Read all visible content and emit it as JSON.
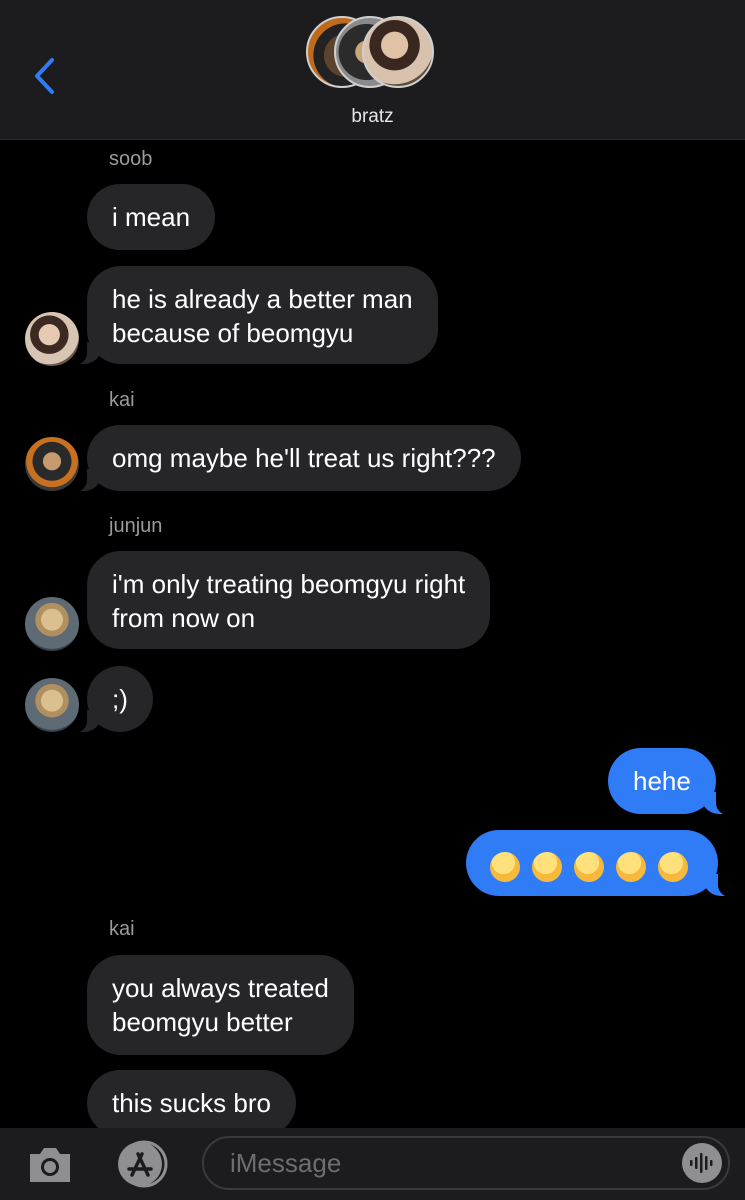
{
  "header": {
    "group_name": "bratz"
  },
  "messages": [
    {
      "type": "sender",
      "name": "soob"
    },
    {
      "type": "incoming",
      "lines": [
        "i mean"
      ]
    },
    {
      "type": "incoming",
      "lines": [
        "he is already a better man",
        "because of beomgyu"
      ]
    },
    {
      "type": "sender",
      "name": "kai"
    },
    {
      "type": "incoming",
      "lines": [
        "omg maybe he'll treat us right???"
      ]
    },
    {
      "type": "sender",
      "name": "junjun"
    },
    {
      "type": "incoming",
      "lines": [
        "i'm only treating beomgyu right",
        "from now on"
      ]
    },
    {
      "type": "incoming",
      "lines": [
        ";)"
      ]
    },
    {
      "type": "outgoing",
      "lines": [
        "hehe"
      ]
    },
    {
      "type": "outgoing",
      "emoji": [
        "face-with-hand-over-mouth",
        "face-with-hand-over-mouth",
        "face-with-hand-over-mouth",
        "face-with-hand-over-mouth",
        "face-with-hand-over-mouth"
      ]
    },
    {
      "type": "sender",
      "name": "kai"
    },
    {
      "type": "incoming",
      "lines": [
        "you always treated",
        "beomgyu better"
      ]
    },
    {
      "type": "incoming",
      "lines": [
        "this sucks bro"
      ]
    }
  ],
  "composer": {
    "placeholder": "iMessage"
  },
  "colors": {
    "outgoing_bubble": "#2f7cf6",
    "incoming_bubble": "#262629",
    "accent": "#2f7cf6"
  }
}
